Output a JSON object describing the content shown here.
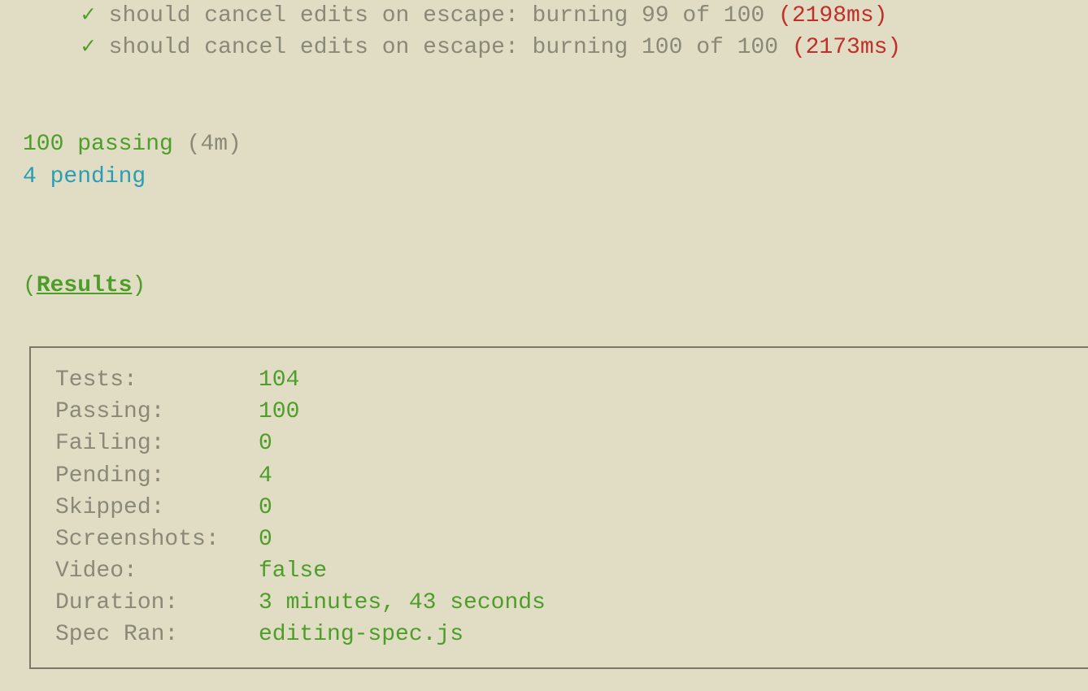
{
  "tests": [
    {
      "check": "✓",
      "name": "should cancel edits on escape: burning 99 of 100 ",
      "time": "(2198ms)"
    },
    {
      "check": "✓",
      "name": "should cancel edits on escape: burning 100 of 100 ",
      "time": "(2173ms)"
    }
  ],
  "summary": {
    "passing_count": "100 passing",
    "passing_time": " (4m)",
    "pending_count": "4 pending"
  },
  "results_header": {
    "open": "(",
    "label": "Results",
    "close": ")"
  },
  "results": {
    "tests_label": "Tests:",
    "tests_value": "104",
    "passing_label": "Passing:",
    "passing_value": "100",
    "failing_label": "Failing:",
    "failing_value": "0",
    "pending_label": "Pending:",
    "pending_value": "4",
    "skipped_label": "Skipped:",
    "skipped_value": "0",
    "screenshots_label": "Screenshots:",
    "screenshots_value": "0",
    "video_label": "Video:",
    "video_value": "false",
    "duration_label": "Duration:",
    "duration_value": "3 minutes, 43 seconds",
    "spec_label": "Spec Ran:",
    "spec_value": "editing-spec.js"
  }
}
